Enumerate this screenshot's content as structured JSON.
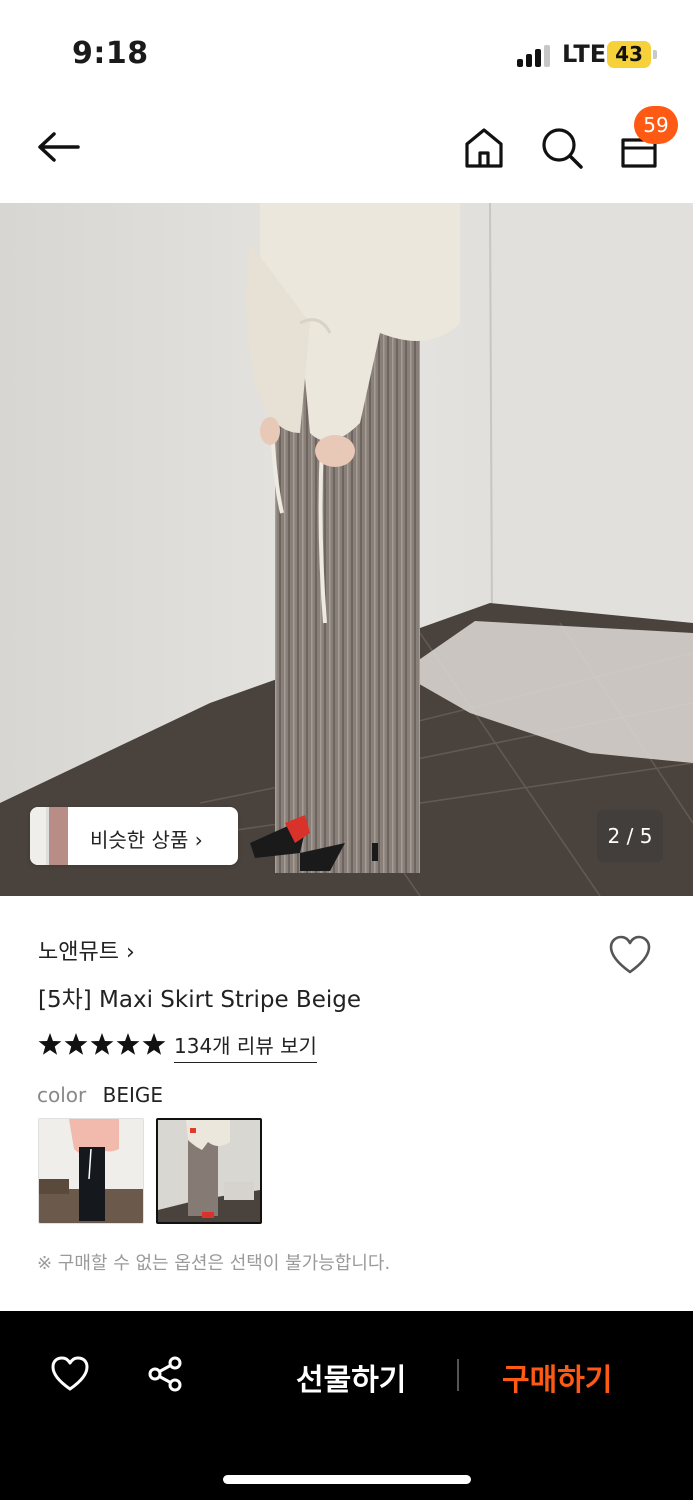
{
  "status_bar": {
    "time": "9:18",
    "network": "LTE",
    "battery": "43"
  },
  "nav": {
    "cart_count": "59"
  },
  "hero": {
    "similar_label": "비슷한 상품  ›",
    "pager": "2 / 5"
  },
  "product": {
    "brand": "노앤뮤트  ›",
    "title": "[5차] Maxi Skirt Stripe Beige",
    "rating_stars": 5,
    "review_link": "134개 리뷰 보기",
    "option_label": "color",
    "option_value": "BEIGE",
    "notice": "※ 구매할 수 없는 옵션은 선택이 불가능합니다."
  },
  "bottom_bar": {
    "gift_label": "선물하기",
    "buy_label": "구매하기"
  },
  "colors": {
    "accent": "#ff5a14",
    "battery": "#f6d13a",
    "bottom_bar": "#000000"
  }
}
